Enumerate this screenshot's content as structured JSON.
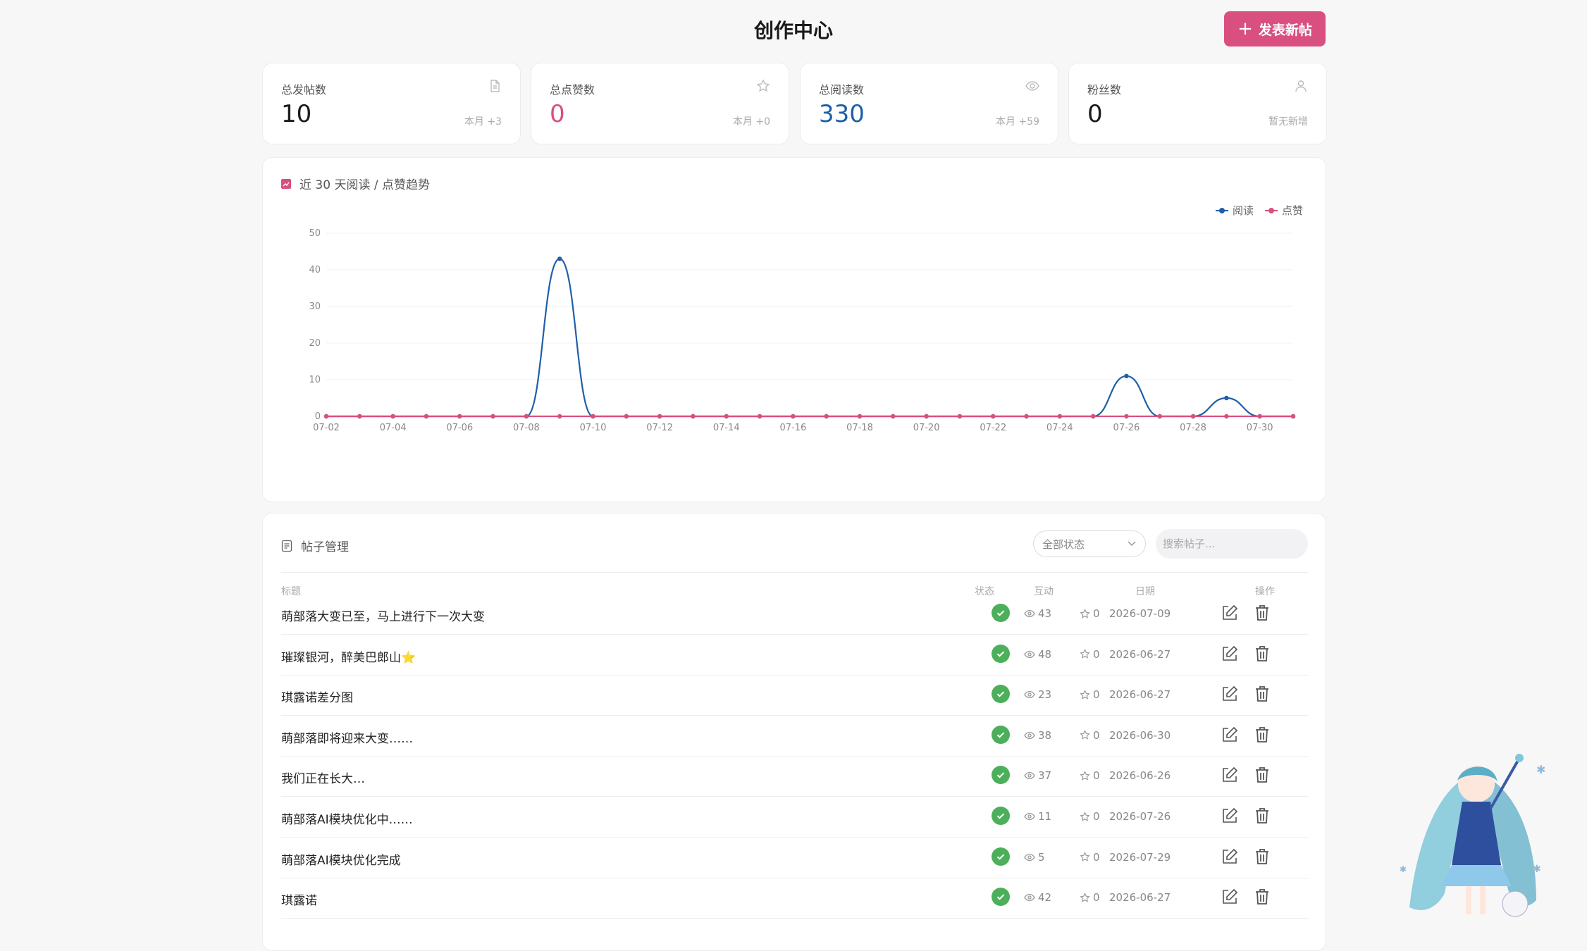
{
  "page": {
    "title": "创作中心",
    "new_post_label": "发表新帖"
  },
  "stats": [
    {
      "label": "总发帖数",
      "value": "10",
      "note": "本月 +3",
      "icon": "document-icon",
      "color": "#1a1a1a"
    },
    {
      "label": "总点赞数",
      "value": "0",
      "note": "本月 +0",
      "icon": "star-icon",
      "color": "#d94f80"
    },
    {
      "label": "总阅读数",
      "value": "330",
      "note": "本月 +59",
      "icon": "eye-icon",
      "color": "#1f5fa8"
    },
    {
      "label": "粉丝数",
      "value": "0",
      "note": "暂无新增",
      "icon": "user-icon",
      "color": "#1a1a1a"
    }
  ],
  "trend": {
    "title": "近 30 天阅读 / 点赞趋势"
  },
  "chart_data": {
    "type": "line",
    "x": [
      "07-02",
      "07-03",
      "07-04",
      "07-05",
      "07-06",
      "07-07",
      "07-08",
      "07-09",
      "07-10",
      "07-11",
      "07-12",
      "07-13",
      "07-14",
      "07-15",
      "07-16",
      "07-17",
      "07-18",
      "07-19",
      "07-20",
      "07-21",
      "07-22",
      "07-23",
      "07-24",
      "07-25",
      "07-26",
      "07-27",
      "07-28",
      "07-29",
      "07-30",
      "07-31"
    ],
    "xticks": [
      "07-02",
      "07-04",
      "07-06",
      "07-08",
      "07-10",
      "07-12",
      "07-14",
      "07-16",
      "07-18",
      "07-20",
      "07-22",
      "07-24",
      "07-26",
      "07-28",
      "07-30"
    ],
    "series": [
      {
        "name": "阅读",
        "color": "#1f5fa8",
        "values": [
          0,
          0,
          0,
          0,
          0,
          0,
          0,
          43,
          0,
          0,
          0,
          0,
          0,
          0,
          0,
          0,
          0,
          0,
          0,
          0,
          0,
          0,
          0,
          0,
          11,
          0,
          0,
          5,
          0,
          0
        ]
      },
      {
        "name": "点赞",
        "color": "#d94f80",
        "values": [
          0,
          0,
          0,
          0,
          0,
          0,
          0,
          0,
          0,
          0,
          0,
          0,
          0,
          0,
          0,
          0,
          0,
          0,
          0,
          0,
          0,
          0,
          0,
          0,
          0,
          0,
          0,
          0,
          0,
          0
        ]
      }
    ],
    "yticks": [
      0,
      10,
      20,
      30,
      40,
      50
    ],
    "ylim": [
      0,
      50
    ],
    "legend": "top-right",
    "grid": true
  },
  "posts": {
    "title": "帖子管理",
    "filter_value": "全部状态",
    "search_placeholder": "搜索帖子...",
    "headers": {
      "title": "标题",
      "status": "状态",
      "interaction": "互动",
      "date": "日期",
      "actions": "操作"
    },
    "rows": [
      {
        "title": "萌部落大变已至，马上进行下一次大变",
        "views": "43",
        "likes": "0",
        "date": "2026-07-09"
      },
      {
        "title": "璀璨银河，醉美巴郎山⭐",
        "views": "48",
        "likes": "0",
        "date": "2026-06-27"
      },
      {
        "title": "琪露诺差分图",
        "views": "23",
        "likes": "0",
        "date": "2026-06-27"
      },
      {
        "title": "萌部落即将迎来大变……",
        "views": "38",
        "likes": "0",
        "date": "2026-06-30"
      },
      {
        "title": "我们正在长大…",
        "views": "37",
        "likes": "0",
        "date": "2026-06-26"
      },
      {
        "title": "萌部落AI模块优化中……",
        "views": "11",
        "likes": "0",
        "date": "2026-07-26"
      },
      {
        "title": "萌部落AI模块优化完成",
        "views": "5",
        "likes": "0",
        "date": "2026-07-29"
      },
      {
        "title": "琪露诺",
        "views": "42",
        "likes": "0",
        "date": "2026-06-27"
      }
    ]
  }
}
